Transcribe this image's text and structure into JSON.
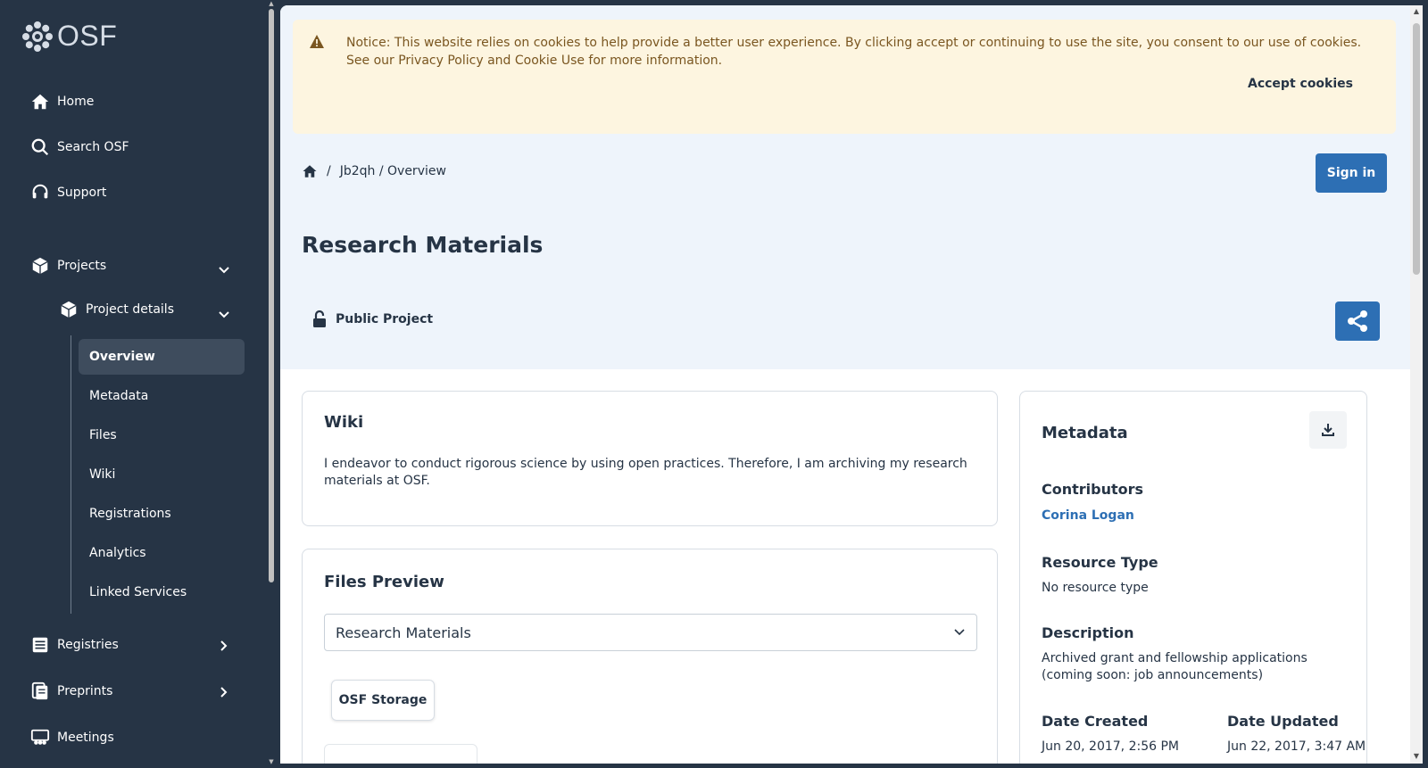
{
  "app": {
    "logo_text": "OSF"
  },
  "sidebar": {
    "home": "Home",
    "search": "Search OSF",
    "support": "Support",
    "projects": "Projects",
    "project_details": "Project details",
    "sub_items": [
      "Overview",
      "Metadata",
      "Files",
      "Wiki",
      "Registrations",
      "Analytics",
      "Linked Services"
    ],
    "registries": "Registries",
    "preprints": "Preprints",
    "meetings": "Meetings"
  },
  "notice": {
    "text": "Notice: This website relies on cookies to help provide a better user experience. By clicking accept or continuing to use the site, you consent to our use of cookies. See our Privacy Policy and Cookie Use for more information.",
    "accept": "Accept cookies"
  },
  "breadcrumb": {
    "sep": "/",
    "path": "Jb2qh / Overview"
  },
  "sign_in": "Sign in",
  "project": {
    "title": "Research Materials",
    "visibility": "Public Project"
  },
  "wiki": {
    "heading": "Wiki",
    "text": "I endeavor to conduct rigorous science by using open practices. Therefore, I am archiving my research materials at OSF."
  },
  "files": {
    "heading": "Files Preview",
    "selected": "Research Materials",
    "storage": "OSF Storage"
  },
  "metadata": {
    "heading": "Metadata",
    "contributors_label": "Contributors",
    "contributor": "Corina Logan",
    "resource_type_label": "Resource Type",
    "resource_type": "No resource type",
    "description_label": "Description",
    "description": "Archived grant and fellowship applications (coming soon: job announcements)",
    "date_created_label": "Date Created",
    "date_created": "Jun 20, 2017, 2:56 PM",
    "date_updated_label": "Date Updated",
    "date_updated": "Jun 22, 2017, 3:47 AM"
  },
  "colors": {
    "sidebar": "#263445",
    "primary": "#2d6fb4",
    "hero": "#eef4fb",
    "notice_bg": "#fdf5e0",
    "notice_text": "#7a5620"
  }
}
